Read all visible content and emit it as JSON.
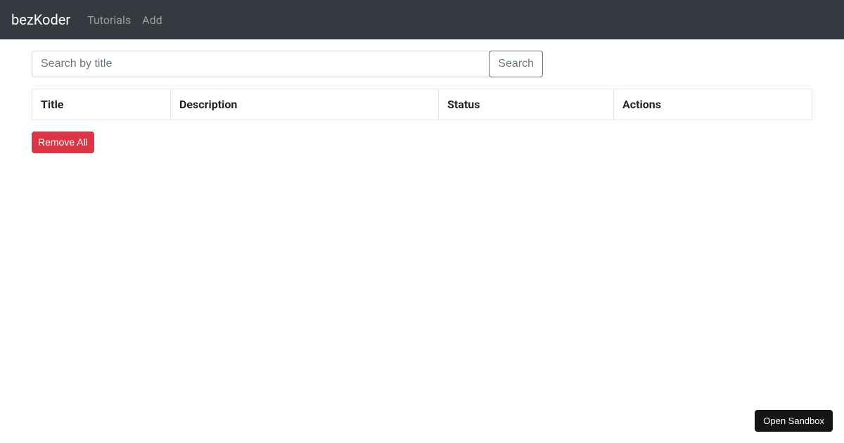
{
  "navbar": {
    "brand": "bezKoder",
    "links": [
      {
        "label": "Tutorials"
      },
      {
        "label": "Add"
      }
    ]
  },
  "search": {
    "placeholder": "Search by title",
    "value": "",
    "button_label": "Search"
  },
  "table": {
    "columns": [
      {
        "label": "Title"
      },
      {
        "label": "Description"
      },
      {
        "label": "Status"
      },
      {
        "label": "Actions"
      }
    ],
    "rows": []
  },
  "actions": {
    "remove_all_label": "Remove All"
  },
  "sandbox": {
    "label": "Open Sandbox"
  }
}
